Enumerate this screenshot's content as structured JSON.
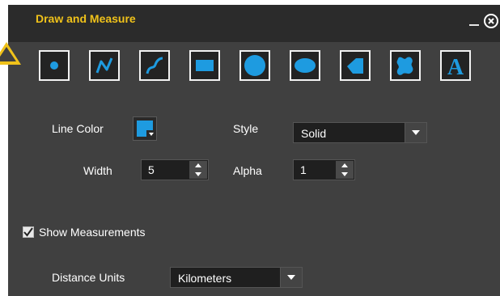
{
  "window": {
    "title": "Draw and Measure"
  },
  "tools": [
    {
      "name": "point-tool",
      "icon": "point-icon"
    },
    {
      "name": "polyline-tool",
      "icon": "polyline-icon"
    },
    {
      "name": "freehand-tool",
      "icon": "freehand-line-icon"
    },
    {
      "name": "rectangle-tool",
      "icon": "rectangle-icon"
    },
    {
      "name": "circle-tool",
      "icon": "circle-icon"
    },
    {
      "name": "ellipse-tool",
      "icon": "ellipse-icon"
    },
    {
      "name": "polygon-tool",
      "icon": "polygon-icon"
    },
    {
      "name": "freehand-polygon-tool",
      "icon": "freehand-polygon-icon"
    },
    {
      "name": "text-tool",
      "icon": "text-icon",
      "glyph": "A"
    }
  ],
  "line_color": {
    "label": "Line Color",
    "value": "#1e9be0"
  },
  "style": {
    "label": "Style",
    "value": "Solid"
  },
  "width": {
    "label": "Width",
    "value": "5"
  },
  "alpha": {
    "label": "Alpha",
    "value": "1"
  },
  "measurements": {
    "label": "Show Measurements",
    "checked": true
  },
  "distance_units": {
    "label": "Distance Units",
    "value": "Kilometers"
  },
  "colors": {
    "accent": "#1e9be0",
    "title": "#f0c21a",
    "panel": "#404040",
    "titlebar": "#2b2b2b"
  }
}
